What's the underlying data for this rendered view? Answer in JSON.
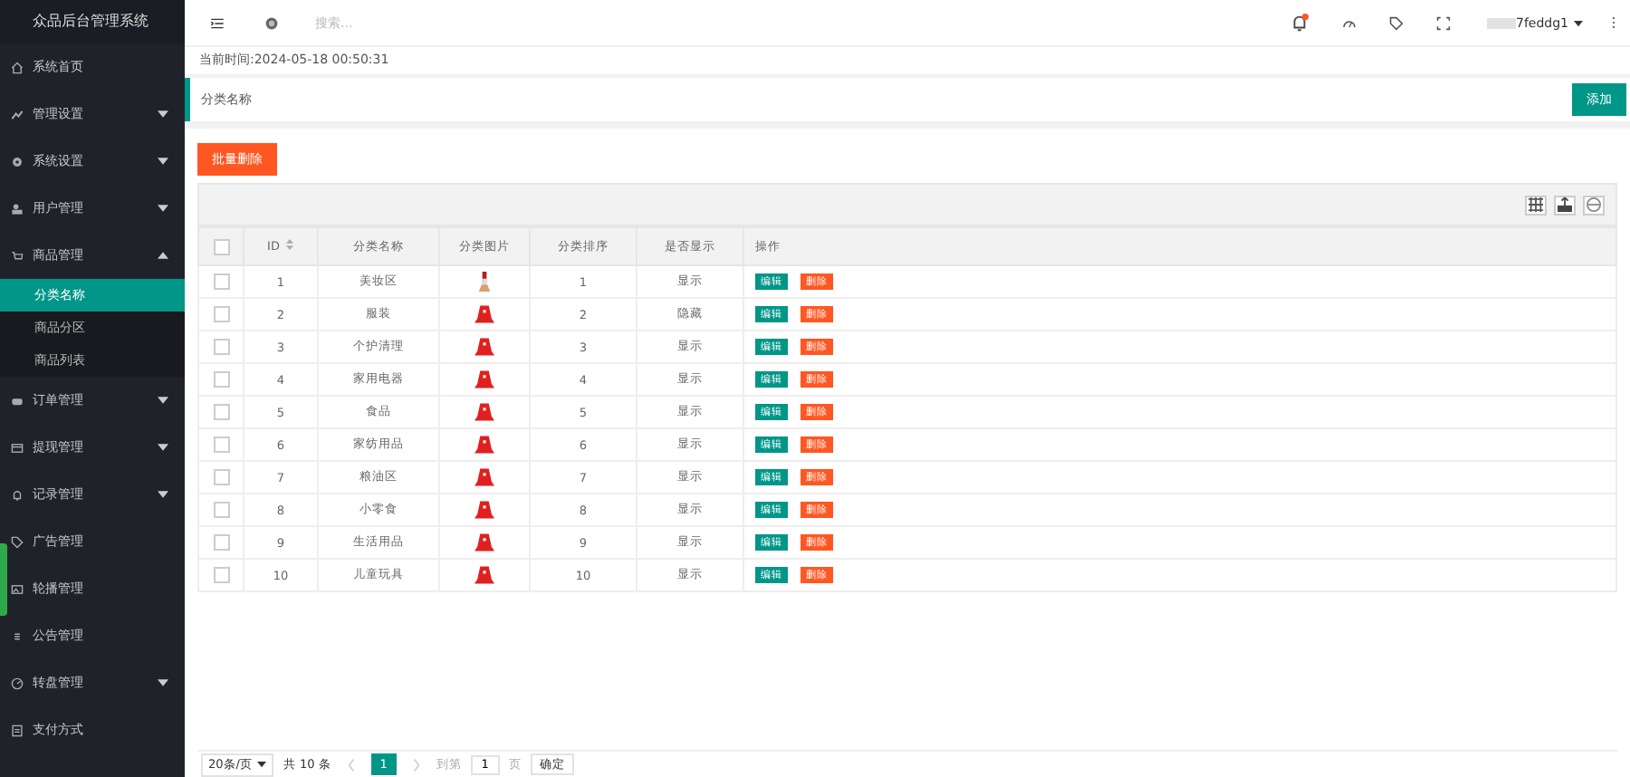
{
  "app": {
    "title": "众品后台管理系统"
  },
  "sidebar": {
    "items": [
      {
        "label": "系统首页"
      },
      {
        "label": "管理设置",
        "expanded": false
      },
      {
        "label": "系统设置",
        "expanded": false
      },
      {
        "label": "用户管理",
        "expanded": false
      },
      {
        "label": "商品管理",
        "expanded": true,
        "children": [
          {
            "label": "分类名称",
            "selected": true
          },
          {
            "label": "商品分区",
            "selected": false
          },
          {
            "label": "商品列表",
            "selected": false
          }
        ]
      },
      {
        "label": "订单管理",
        "expanded": false
      },
      {
        "label": "提现管理",
        "expanded": false
      },
      {
        "label": "记录管理",
        "expanded": false
      },
      {
        "label": "广告管理"
      },
      {
        "label": "轮播管理"
      },
      {
        "label": "公告管理"
      },
      {
        "label": "转盘管理",
        "expanded": false
      },
      {
        "label": "支付方式"
      }
    ]
  },
  "header": {
    "search": {
      "placeholder": "搜索..."
    },
    "notification": true,
    "user": "7feddg1"
  },
  "current_time": "当前时间:2024-05-18 00:50:31",
  "breadcrumb": "分类名称",
  "add_button": "添加",
  "batch_delete_button": "批量删除",
  "table": {
    "all_checked": false,
    "columns": [
      "ID",
      "分类名称",
      "分类图片",
      "分类排序",
      "是否显示",
      "操作"
    ],
    "rows": [
      {
        "id": "1",
        "name": "美妆区",
        "kind": "lipstick",
        "sort": "1",
        "display": "显示",
        "edit": "编辑",
        "delete": "删除",
        "checked": false
      },
      {
        "id": "2",
        "name": "服装",
        "kind": "product",
        "sort": "2",
        "display": "隐藏",
        "edit": "编辑",
        "delete": "删除",
        "checked": false
      },
      {
        "id": "3",
        "name": "个护清理",
        "kind": "product",
        "sort": "3",
        "display": "显示",
        "edit": "编辑",
        "delete": "删除",
        "checked": false
      },
      {
        "id": "4",
        "name": "家用电器",
        "kind": "product",
        "sort": "4",
        "display": "显示",
        "edit": "编辑",
        "delete": "删除",
        "checked": false
      },
      {
        "id": "5",
        "name": "食品",
        "kind": "product",
        "sort": "5",
        "display": "显示",
        "edit": "编辑",
        "delete": "删除",
        "checked": false
      },
      {
        "id": "6",
        "name": "家纺用品",
        "kind": "product",
        "sort": "6",
        "display": "显示",
        "edit": "编辑",
        "delete": "删除",
        "checked": false
      },
      {
        "id": "7",
        "name": "粮油区",
        "kind": "product",
        "sort": "7",
        "display": "显示",
        "edit": "编辑",
        "delete": "删除",
        "checked": false
      },
      {
        "id": "8",
        "name": "小零食",
        "kind": "product",
        "sort": "8",
        "display": "显示",
        "edit": "编辑",
        "delete": "删除",
        "checked": false
      },
      {
        "id": "9",
        "name": "生活用品",
        "kind": "product",
        "sort": "9",
        "display": "显示",
        "edit": "编辑",
        "delete": "删除",
        "checked": false
      },
      {
        "id": "10",
        "name": "儿童玩具",
        "kind": "product",
        "sort": "10",
        "display": "显示",
        "edit": "编辑",
        "delete": "删除",
        "checked": false
      }
    ]
  },
  "pagination": {
    "page_size": "20条/页",
    "total": "共 10 条",
    "pages": [
      {
        "label": "1",
        "selected": true
      }
    ],
    "goto_label": "到第",
    "goto_value": "1",
    "page_unit": "页",
    "confirm": "确定"
  }
}
